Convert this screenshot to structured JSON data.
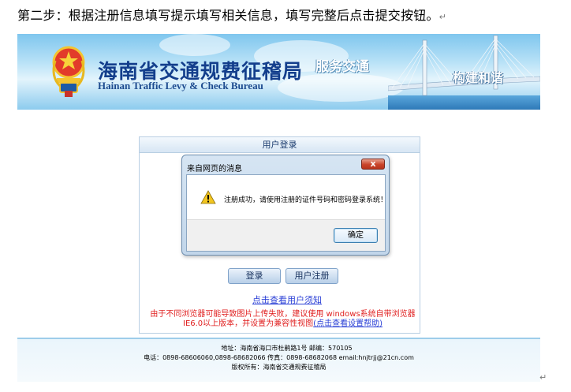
{
  "document": {
    "instruction": "第二步：根据注册信息填写提示填写相关信息，填写完整后点击提交按钮。",
    "paragraph_mark": "↵"
  },
  "banner": {
    "title_cn": "海南省交通规费征稽局",
    "title_en": "Hainan Traffic Levy & Check Bureau",
    "slogan_left": "服务交通",
    "slogan_right": "构建和谐"
  },
  "login_panel": {
    "title": "用户登录",
    "login_button": "登录",
    "register_button": "用户注册",
    "notice_link": "点击查看用户须知",
    "browser_warning": "由于不同浏览器可能导致图片上传失败，建议使用 windows系统自带浏览器 IE6.0以上版本，并设置为兼容性视图",
    "settings_link": "(点击查看设置帮助)"
  },
  "dialog": {
    "title": "来自网页的消息",
    "close_label": "x",
    "message": "注册成功，请使用注册的证件号码和密码登录系统！",
    "ok_button": "确定"
  },
  "footer": {
    "address": "地址：海南省海口市杜鹃路1号  邮编：570105",
    "contact": "电话：0898-68606060,0898-68682066 传真：0898-68682068 email:hnjtrjj@21cn.com",
    "copyright": "版权所有：海南省交通规费征稽局"
  }
}
